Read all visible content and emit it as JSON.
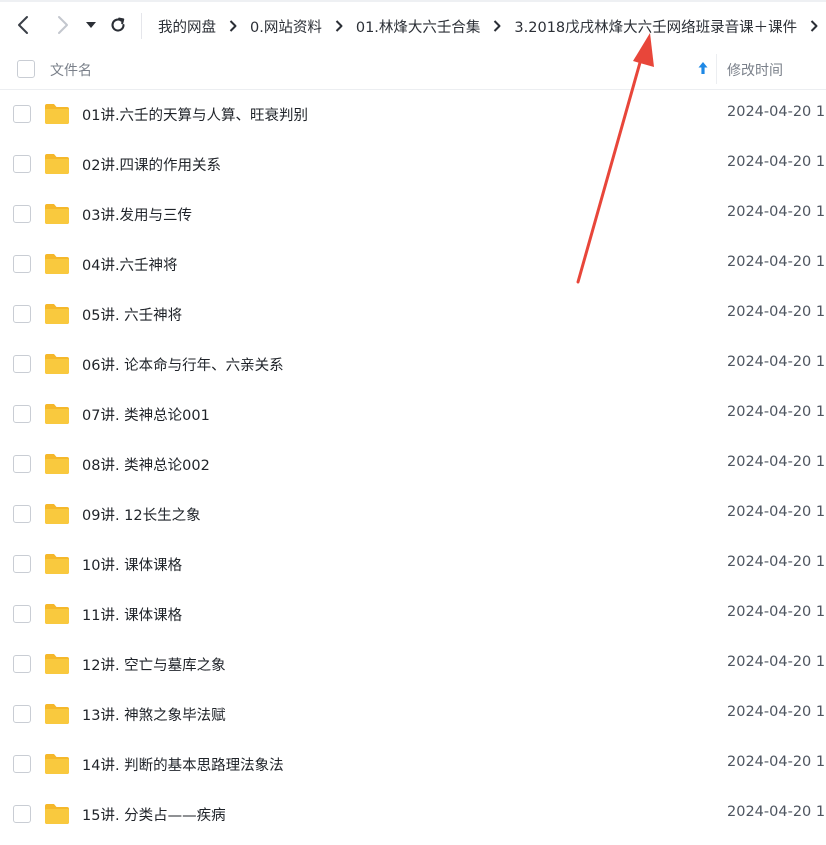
{
  "toolbar": {
    "back_icon": "chevron-left-icon",
    "forward_icon": "chevron-right-icon",
    "history_icon": "caret-down-icon",
    "refresh_icon": "refresh-icon"
  },
  "breadcrumb": [
    "我的网盘",
    "0.网站资料",
    "01.林烽大六壬合集",
    "3.2018戊戌林烽大六壬网络班录音课＋课件"
  ],
  "header": {
    "name_label": "文件名",
    "time_label": "修改时间",
    "sort_icon": "sort-ascending-arrow-icon"
  },
  "files": [
    {
      "name": "01讲.六壬的天算与人算、旺衰判别",
      "time": "2024-04-20 1"
    },
    {
      "name": "02讲.四课的作用关系",
      "time": "2024-04-20 1"
    },
    {
      "name": "03讲.发用与三传",
      "time": "2024-04-20 1"
    },
    {
      "name": "04讲.六壬神将",
      "time": "2024-04-20 1"
    },
    {
      "name": "05讲. 六壬神将",
      "time": "2024-04-20 1"
    },
    {
      "name": "06讲. 论本命与行年、六亲关系",
      "time": "2024-04-20 1"
    },
    {
      "name": "07讲. 类神总论001",
      "time": "2024-04-20 1"
    },
    {
      "name": "08讲. 类神总论002",
      "time": "2024-04-20 1"
    },
    {
      "name": "09讲. 12长生之象",
      "time": "2024-04-20 1"
    },
    {
      "name": "10讲. 课体课格",
      "time": "2024-04-20 1"
    },
    {
      "name": "11讲. 课体课格",
      "time": "2024-04-20 1"
    },
    {
      "name": "12讲. 空亡与墓库之象",
      "time": "2024-04-20 1"
    },
    {
      "name": "13讲. 神煞之象毕法赋",
      "time": "2024-04-20 1"
    },
    {
      "name": "14讲. 判断的基本思路理法象法",
      "time": "2024-04-20 1"
    },
    {
      "name": "15讲. 分类占——疾病",
      "time": "2024-04-20 1"
    }
  ],
  "colors": {
    "folder": "#f9c93e",
    "folder_tab": "#f5b82a",
    "sort_arrow": "#1e88e5",
    "annotation_arrow": "#e8463a"
  },
  "annotation": {
    "type": "red-arrow-pointer"
  }
}
